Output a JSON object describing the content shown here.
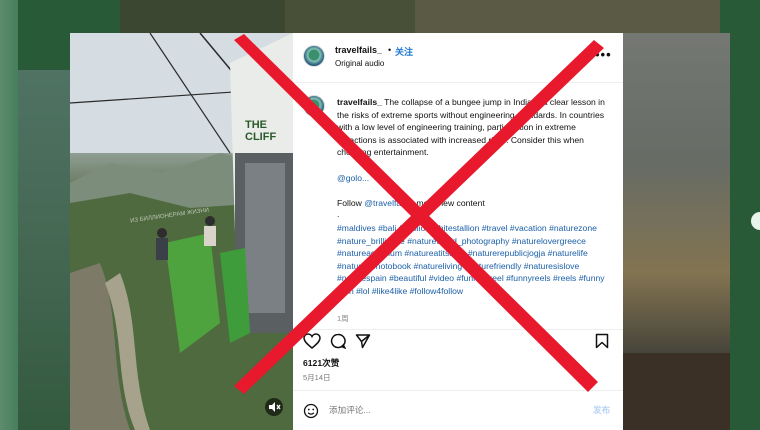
{
  "post": {
    "username": "travelfails_",
    "dot": "•",
    "follow_label": "关注",
    "audio_label": "Original audio",
    "more_label": "•••",
    "caption_username": "travelfails_",
    "caption_text": "The collapse of a bungee jump in India is a clear lesson in the risks of extreme sports without engineering standards. In countries with a low level of engineering training, participation in extreme attractions is associated with increased risks. Consider this when choosing entertainment.",
    "mention": "@golo...",
    "follow_text_prefix": "Follow ",
    "follow_link": "@travelfails_",
    "follow_text_suffix": " more new content",
    "follow_dot": ".",
    "hashtags": "#maldives #bali #stallion whitestallion #travel #vacation #naturezone #nature_brilliance #natureworld_photography #naturelovergreece #natureaquarium #natureatitsbest #naturerepublicjogja #naturelife #nature_photobook #natureliving #naturefriendly #naturesislove #naturespain #beautiful #video #funny #reel #funnyreels #reels #funny #fun #lol #like4like #follow4follow",
    "caption_time": "1周",
    "likes": "6121次赞",
    "date": "5月14日",
    "comment_placeholder": "添加评论...",
    "post_button": "发布"
  },
  "video": {
    "sign_text": "THE CLIFF",
    "watermark": "ИЗ БИЛЛИОНЕРАМ ЖИЗНИ"
  },
  "colors": {
    "accent": "#1f78d1",
    "overlay_x": "#e8192c",
    "background_green": "#3f8a55"
  },
  "icons": [
    "heart-icon",
    "comment-icon",
    "share-icon",
    "bookmark-icon",
    "emoji-icon",
    "mute-icon",
    "more-icon"
  ]
}
